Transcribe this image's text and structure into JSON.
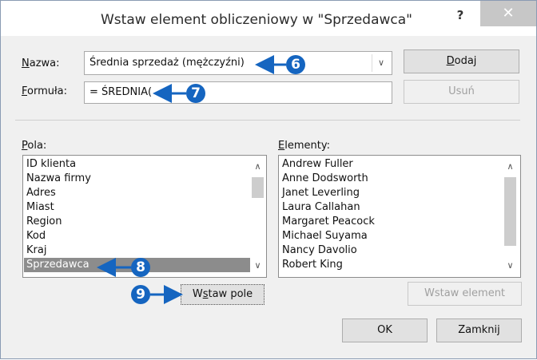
{
  "dialog": {
    "title": "Wstaw element obliczeniowy w \"Sprzedawca\"",
    "help_label": "?",
    "close_label": "✕"
  },
  "name_field": {
    "label_u": "N",
    "label_rest": "azwa:",
    "value": "Średnia sprzedaż (mężczyźni)"
  },
  "formula_field": {
    "label_u": "F",
    "label_rest": "ormuła:",
    "value": "= ŚREDNIA("
  },
  "buttons": {
    "add_u": "D",
    "add_rest": "odaj",
    "delete": "Usuń",
    "insert_field_pre": "W",
    "insert_field_u": "s",
    "insert_field_rest": "taw pole",
    "insert_item": "Wstaw element",
    "ok": "OK",
    "close": "Zamknij"
  },
  "fields_list": {
    "label_u": "P",
    "label_rest": "ola:",
    "items": [
      "ID klienta",
      "Nazwa firmy",
      "Adres",
      "Miast",
      "Region",
      "Kod",
      "Kraj",
      "Sprzedawca"
    ],
    "selected": "Sprzedawca"
  },
  "items_list": {
    "label_u": "E",
    "label_rest": "lementy:",
    "items": [
      "Andrew Fuller",
      "Anne Dodsworth",
      "Janet Leverling",
      "Laura Callahan",
      "Margaret Peacock",
      "Michael Suyama",
      "Nancy Davolio",
      "Robert King"
    ]
  },
  "callouts": {
    "c6": "6",
    "c7": "7",
    "c8": "8",
    "c9": "9"
  },
  "colors": {
    "callout": "#1565c0",
    "selection": "#8c8c8c"
  }
}
